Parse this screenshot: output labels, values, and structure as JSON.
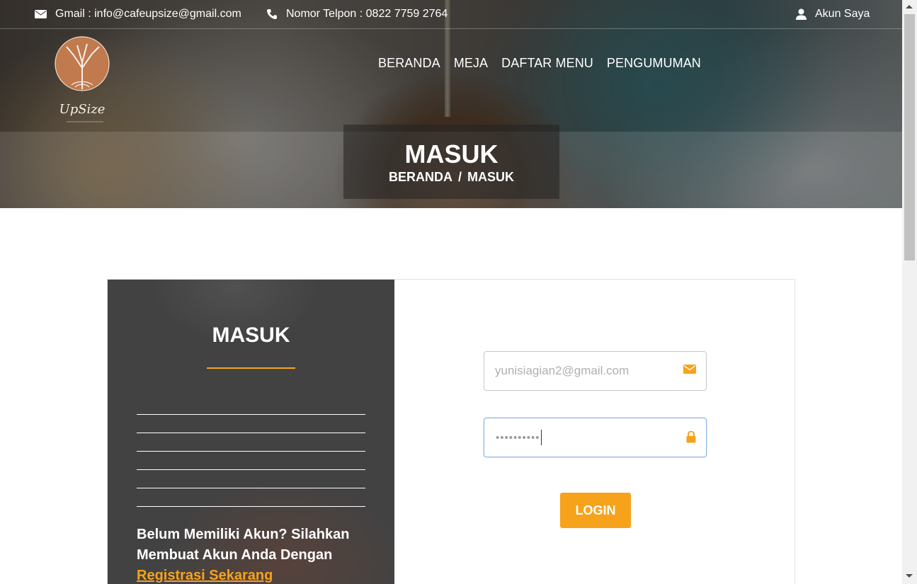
{
  "topbar": {
    "email": "Gmail : info@cafeupsize@gmail.com",
    "phone": "Nomor Telpon : 0822 7759 2764",
    "account": "Akun Saya"
  },
  "logo": {
    "text": "UpSize"
  },
  "nav": {
    "items": [
      "BERANDA",
      "MEJA",
      "DAFTAR MENU",
      "PENGUMUMAN"
    ]
  },
  "hero": {
    "title": "MASUK",
    "breadcrumb": [
      "BERANDA",
      "/",
      "MASUK"
    ]
  },
  "card": {
    "left_title": "MASUK",
    "promo_text": "Belum Memiliki Akun? Silahkan Membuat Akun Anda Dengan",
    "promo_link": "Registrasi Sekarang"
  },
  "form": {
    "email_placeholder": "yunisiagian2@gmail.com",
    "password_mask": "••••••••••",
    "login_label": "LOGIN"
  },
  "colors": {
    "accent": "#f7a21b",
    "focus_border": "#8cb6e8"
  },
  "icons": {
    "email": "envelope-icon",
    "phone": "phone-icon",
    "account": "user-icon",
    "email_field": "envelope-icon",
    "password_field": "lock-icon"
  }
}
